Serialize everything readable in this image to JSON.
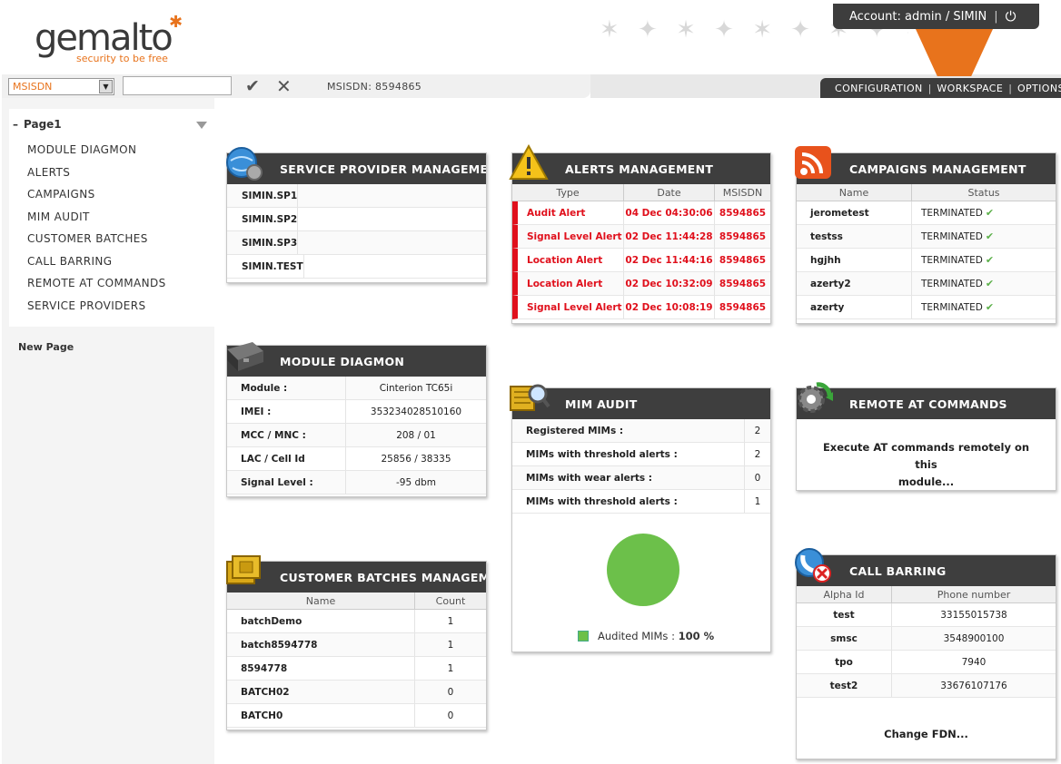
{
  "brand": {
    "logo_text": "gemalto",
    "tagline": "security to be free"
  },
  "account": {
    "label": "Account: admin / SIMIN"
  },
  "search": {
    "type_selected": "MSISDN",
    "input_value": "",
    "msisdn_text": "MSISDN: 8594865"
  },
  "topnav": {
    "items": [
      "CONFIGURATION",
      "WORKSPACE",
      "OPTIONS"
    ]
  },
  "sidebar": {
    "page_title": "Page1",
    "items": [
      "MODULE DIAGMON",
      "ALERTS",
      "CAMPAIGNS",
      "MIM AUDIT",
      "CUSTOMER BATCHES",
      "CALL BARRING",
      "REMOTE AT COMMANDS",
      "SERVICE PROVIDERS"
    ],
    "new_page": "New Page"
  },
  "service_provider": {
    "title": "SERVICE PROVIDER MANAGEMENT",
    "items": [
      "SIMIN.SP1",
      "SIMIN.SP2",
      "SIMIN.SP3",
      "SIMIN.TEST"
    ]
  },
  "alerts": {
    "title": "ALERTS MANAGEMENT",
    "columns": [
      "Type",
      "Date",
      "MSISDN"
    ],
    "rows": [
      [
        "Audit Alert",
        "04 Dec 04:30:06",
        "8594865"
      ],
      [
        "Signal Level Alert",
        "02 Dec 11:44:28",
        "8594865"
      ],
      [
        "Location Alert",
        "02 Dec 11:44:16",
        "8594865"
      ],
      [
        "Location Alert",
        "02 Dec 10:32:09",
        "8594865"
      ],
      [
        "Signal Level Alert",
        "02 Dec 10:08:19",
        "8594865"
      ]
    ]
  },
  "campaigns": {
    "title": "CAMPAIGNS MANAGEMENT",
    "columns": [
      "Name",
      "Status"
    ],
    "rows": [
      [
        "jerometest",
        "TERMINATED"
      ],
      [
        "testss",
        "TERMINATED"
      ],
      [
        "hgjhh",
        "TERMINATED"
      ],
      [
        "azerty2",
        "TERMINATED"
      ],
      [
        "azerty",
        "TERMINATED"
      ]
    ]
  },
  "module": {
    "title": "MODULE DIAGMON",
    "rows": [
      [
        "Module :",
        "Cinterion TC65i"
      ],
      [
        "IMEI :",
        "353234028510160"
      ],
      [
        "MCC / MNC :",
        "208 / 01"
      ],
      [
        "LAC / Cell Id",
        "25856 / 38335"
      ],
      [
        "Signal Level :",
        "-95 dbm"
      ]
    ]
  },
  "mim": {
    "title": "MIM AUDIT",
    "rows": [
      [
        "Registered MIMs :",
        "2"
      ],
      [
        "MIMs with threshold alerts :",
        "2"
      ],
      [
        "MIMs with wear alerts :",
        "0"
      ],
      [
        "MIMs with threshold alerts :",
        "1"
      ]
    ],
    "legend_label": "Audited MIMs :",
    "legend_value": "100 %"
  },
  "chart_data": {
    "type": "pie",
    "categories": [
      "Audited MIMs"
    ],
    "values": [
      100
    ],
    "colors": [
      "#6cc04a"
    ]
  },
  "remote_at": {
    "title": "REMOTE AT COMMANDS",
    "line1": "Execute AT commands remotely on this",
    "line2": "module..."
  },
  "customer_batches": {
    "title": "CUSTOMER BATCHES MANAGEMENT",
    "columns": [
      "Name",
      "Count"
    ],
    "rows": [
      [
        "batchDemo",
        "1"
      ],
      [
        "batch8594778",
        "1"
      ],
      [
        "8594778",
        "1"
      ],
      [
        "BATCH02",
        "0"
      ],
      [
        "BATCH0",
        "0"
      ]
    ]
  },
  "call_barring": {
    "title": "CALL BARRING",
    "columns": [
      "Alpha Id",
      "Phone number"
    ],
    "rows": [
      [
        "test",
        "33155015738"
      ],
      [
        "smsc",
        "3548900100"
      ],
      [
        "tpo",
        "7940"
      ],
      [
        "test2",
        "33676107176"
      ]
    ],
    "action": "Change FDN..."
  },
  "colors": {
    "accent": "#e8731c",
    "header_dark": "#3e3e3e",
    "alert_red": "#e0101c",
    "ok_green": "#6cc04a"
  }
}
